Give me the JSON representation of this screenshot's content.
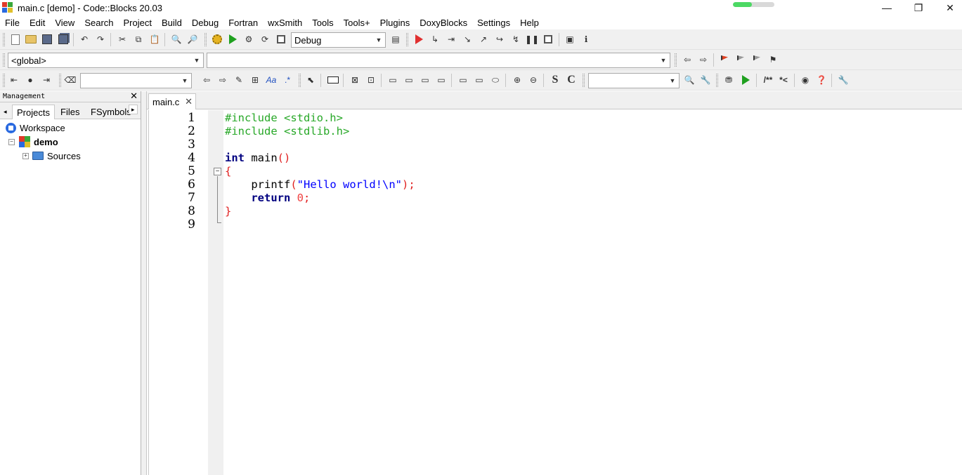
{
  "window": {
    "title": "main.c [demo] - Code::Blocks 20.03",
    "progress": 0.45,
    "controls": {
      "minimize": "—",
      "maximize": "❐",
      "close": "✕"
    }
  },
  "menu": [
    "File",
    "Edit",
    "View",
    "Search",
    "Project",
    "Build",
    "Debug",
    "Fortran",
    "wxSmith",
    "Tools",
    "Tools+",
    "Plugins",
    "DoxyBlocks",
    "Settings",
    "Help"
  ],
  "toolbar": {
    "build_target": "Debug",
    "scope": "<global>",
    "symbol": "",
    "search_text": "",
    "find_text": "",
    "letters": {
      "s": "S",
      "c": "C",
      "doxy_block": "/**",
      "doxy_line": "*<",
      "regex": ".*",
      "match_case": "Aa"
    }
  },
  "management": {
    "title": "Management",
    "close": "✕",
    "tab_prev": "◂",
    "tab_next": "▸",
    "tabs": [
      "Projects",
      "Files",
      "FSymbols"
    ],
    "active_tab": "Projects",
    "tree": {
      "workspace": "Workspace",
      "project": "demo",
      "folder": "Sources",
      "expander_open": "−",
      "expander_closed": "+"
    }
  },
  "editor": {
    "tab_label": "main.c",
    "tab_close": "✕",
    "fold_marker": "−",
    "line_numbers": [
      "1",
      "2",
      "3",
      "4",
      "5",
      "6",
      "7",
      "8",
      "9"
    ],
    "code": {
      "l1": "#include <stdio.h>",
      "l2": "#include <stdlib.h>",
      "l4_kw": "int",
      "l4_rest": " main",
      "l4_paren": "()",
      "l5": "{",
      "l6_fn": "    printf",
      "l6_open": "(",
      "l6_str": "\"Hello world!\\n\"",
      "l6_close": ");",
      "l7_kw": "    return",
      "l7_num": " 0",
      "l7_semi": ";",
      "l8": "}"
    }
  },
  "colors": {
    "preprocessor": "#28a828",
    "keyword": "#000080",
    "string": "#0000ff",
    "number": "#f04040",
    "operator": "#e02020",
    "toolbar_bg": "#f0f0f0"
  }
}
